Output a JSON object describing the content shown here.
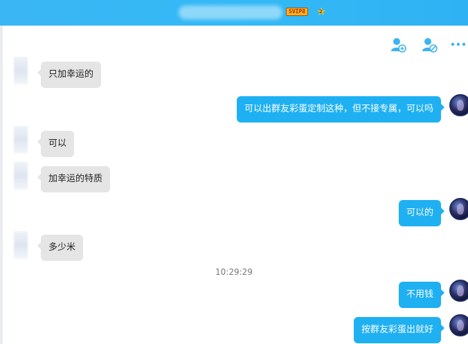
{
  "titlebar": {
    "vip_label": "SVIP8",
    "star_level": "2",
    "accent_color": "#34b9f6"
  },
  "toolbar": {
    "add_member_icon": "add-user-icon",
    "block_icon": "block-user-icon",
    "more_icon": "more-icon"
  },
  "messages": [
    {
      "side": "in",
      "text": "只加幸运的"
    },
    {
      "side": "out",
      "text": "可以出群友彩蛋定制这种，但不接专属，可以吗"
    },
    {
      "side": "in",
      "text": "可以"
    },
    {
      "side": "in",
      "text": "加幸运的特质"
    },
    {
      "side": "out",
      "text": "可以的"
    },
    {
      "side": "in",
      "text": "多少米"
    },
    {
      "side": "out",
      "text": "不用钱"
    },
    {
      "side": "out",
      "text": "按群友彩蛋出就好"
    }
  ],
  "timestamp": "10:29:29"
}
